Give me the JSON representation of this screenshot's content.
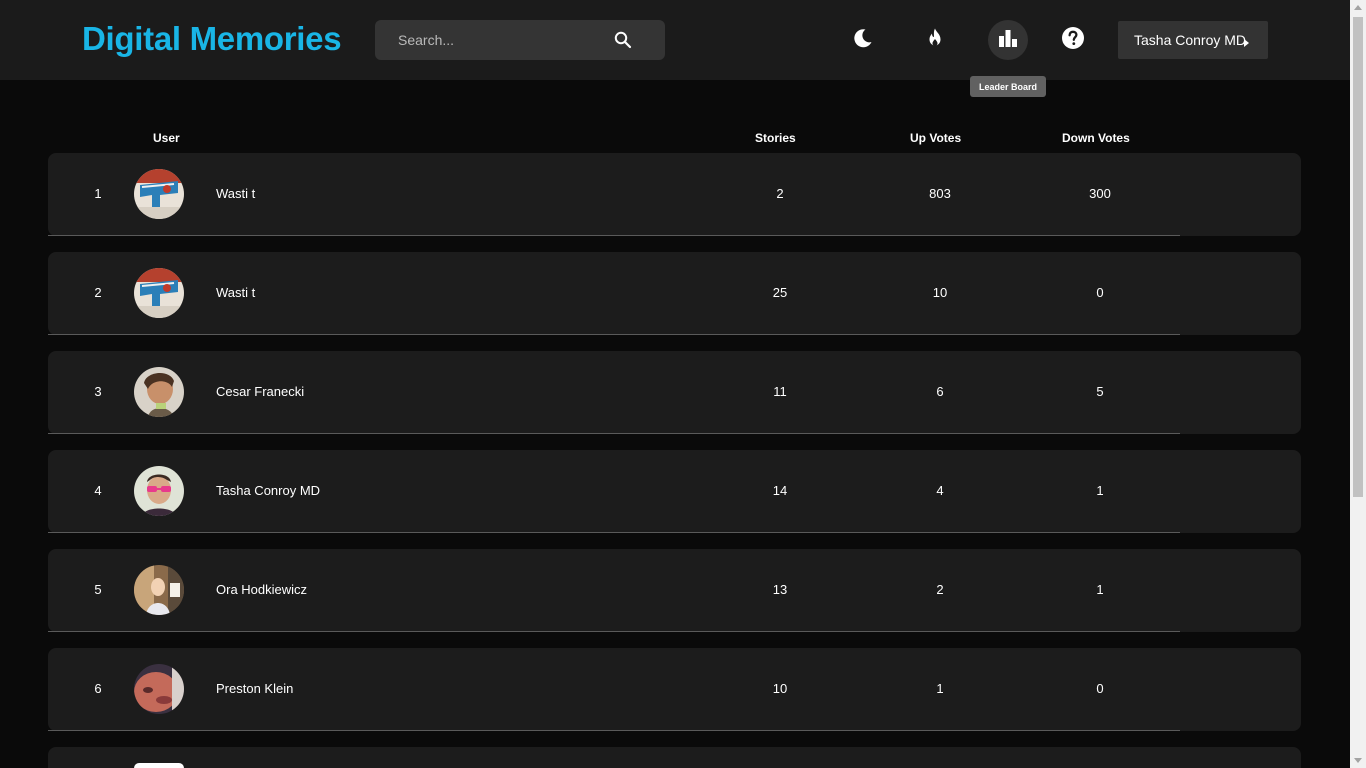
{
  "header": {
    "brand": "Digital Memories",
    "search": {
      "placeholder": "Search...",
      "value": ""
    },
    "icons": {
      "theme": "moon-icon",
      "trending": "flame-icon",
      "leaderboard": "bar-chart-icon",
      "help": "help-icon",
      "search": "search-icon"
    },
    "tooltip": "Leader Board",
    "user_menu": {
      "name": "Tasha Conroy MD"
    }
  },
  "colors": {
    "brand": "#19b5e6",
    "header_bg": "#1b1b1b",
    "page_bg": "#0a0a0a",
    "row_bg": "#1c1c1c"
  },
  "table": {
    "columns": {
      "user": "User",
      "stories": "Stories",
      "up_votes": "Up Votes",
      "down_votes": "Down Votes"
    },
    "rows": [
      {
        "rank": "1",
        "name": "Wasti t",
        "stories": "2",
        "up_votes": "803",
        "down_votes": "300",
        "avatar": "avatar-graffiti"
      },
      {
        "rank": "2",
        "name": "Wasti t",
        "stories": "25",
        "up_votes": "10",
        "down_votes": "0",
        "avatar": "avatar-graffiti"
      },
      {
        "rank": "3",
        "name": "Cesar Franecki",
        "stories": "11",
        "up_votes": "6",
        "down_votes": "5",
        "avatar": "avatar-man-brown"
      },
      {
        "rank": "4",
        "name": "Tasha Conroy MD",
        "stories": "14",
        "up_votes": "4",
        "down_votes": "1",
        "avatar": "avatar-man-sunglasses"
      },
      {
        "rank": "5",
        "name": "Ora Hodkiewicz",
        "stories": "13",
        "up_votes": "2",
        "down_votes": "1",
        "avatar": "avatar-person-room"
      },
      {
        "rank": "6",
        "name": "Preston Klein",
        "stories": "10",
        "up_votes": "1",
        "down_votes": "0",
        "avatar": "avatar-face-closeup"
      }
    ]
  }
}
